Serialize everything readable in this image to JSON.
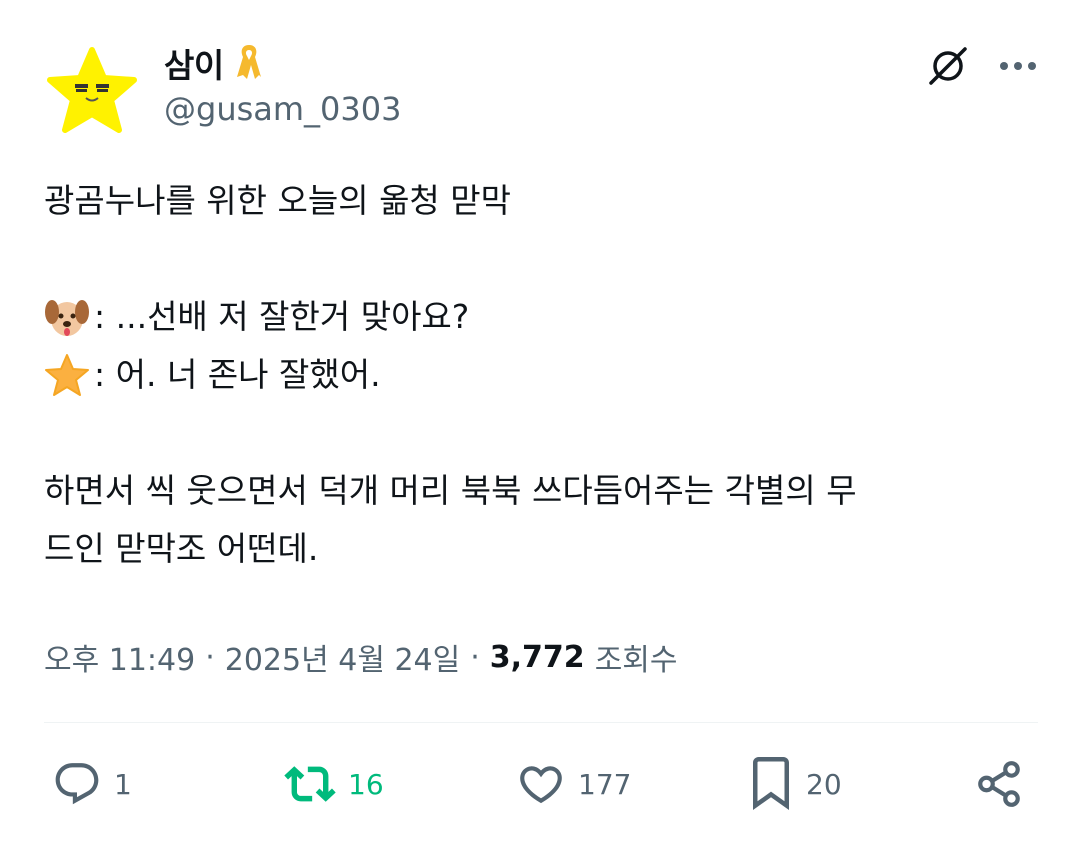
{
  "author": {
    "display_name": "삼이",
    "handle": "@gusam_0303",
    "badge_icon": "yellow-ribbon-icon",
    "avatar_icon": "yellow-star-face-icon"
  },
  "header_actions": {
    "grok_icon": "grok-icon",
    "more_icon": "more-dots-icon"
  },
  "tweet": {
    "line1": "광곰누나를 위한 오늘의 옮청 맏막",
    "line2_emoji": "dog-face-emoji",
    "line2_text": ": ...선배 저 잘한거 맞아요?",
    "line3_emoji": "star-emoji",
    "line3_text": ": 어. 너 존나 잘했어.",
    "line4": "하면서 씩 웃으면서 덕개 머리 북북 쓰다듬어주는 각별의 무",
    "line5": "드인 맏막조 어떤데."
  },
  "meta": {
    "time": "오후 11:49",
    "dot": "·",
    "date": "2025년 4월 24일",
    "views_count": "3,772",
    "views_label": "조회수"
  },
  "actions": {
    "reply_count": "1",
    "retweet_count": "16",
    "like_count": "177",
    "bookmark_count": "20"
  },
  "colors": {
    "text": "#0f1419",
    "secondary": "#536471",
    "retweet_green": "#00ba7c",
    "divider": "#eff3f4",
    "star_yellow": "#fff200"
  }
}
